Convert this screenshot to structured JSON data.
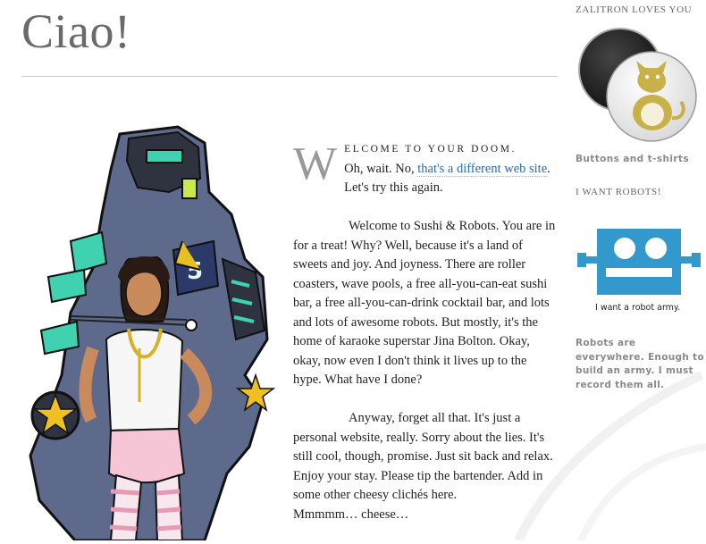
{
  "page": {
    "title": "Ciao!"
  },
  "intro": {
    "dropcap": "W",
    "lead": "elcome to your doom.",
    "line_before_link": "Oh, wait. No, ",
    "link_text": "that's a different web site",
    "line_after_link": ". Let's try this again."
  },
  "paragraphs": [
    "Welcome to Sushi & Robots. You are in for a treat! Why? Well, because it's a land of sweets and joy. And joyness. There are roller coasters, wave pools, a free all-you-can-eat sushi bar, a free all-you-can-drink cocktail bar, and lots and lots of awesome robots. But mostly, it's the home of karaoke superstar Jina Bolton. Okay, okay, now even I don't think it lives up to the hype. What have I done?",
    "Anyway, forget all that. It's just a personal website, really. Sorry about the lies. It's still cool, though, promise. Just sit back and relax. Enjoy your stay. Please tip the bartender. Add in some other cheesy clichés here."
  ],
  "closing": "Mmmmm… cheese…",
  "sidebar": {
    "heading1": "Zalitron loves you",
    "badges_link": "Buttons and t-shirts",
    "heading2": "I want robots!",
    "robot_caption": "I want a robot army.",
    "robots_text": "Robots are everywhere. Enough to build an army. I must record them all."
  },
  "colors": {
    "title": "#6a6a6a",
    "link": "#2b6ca3",
    "robot_blue": "#3399cc",
    "badge_cat": "#c8b14a"
  }
}
